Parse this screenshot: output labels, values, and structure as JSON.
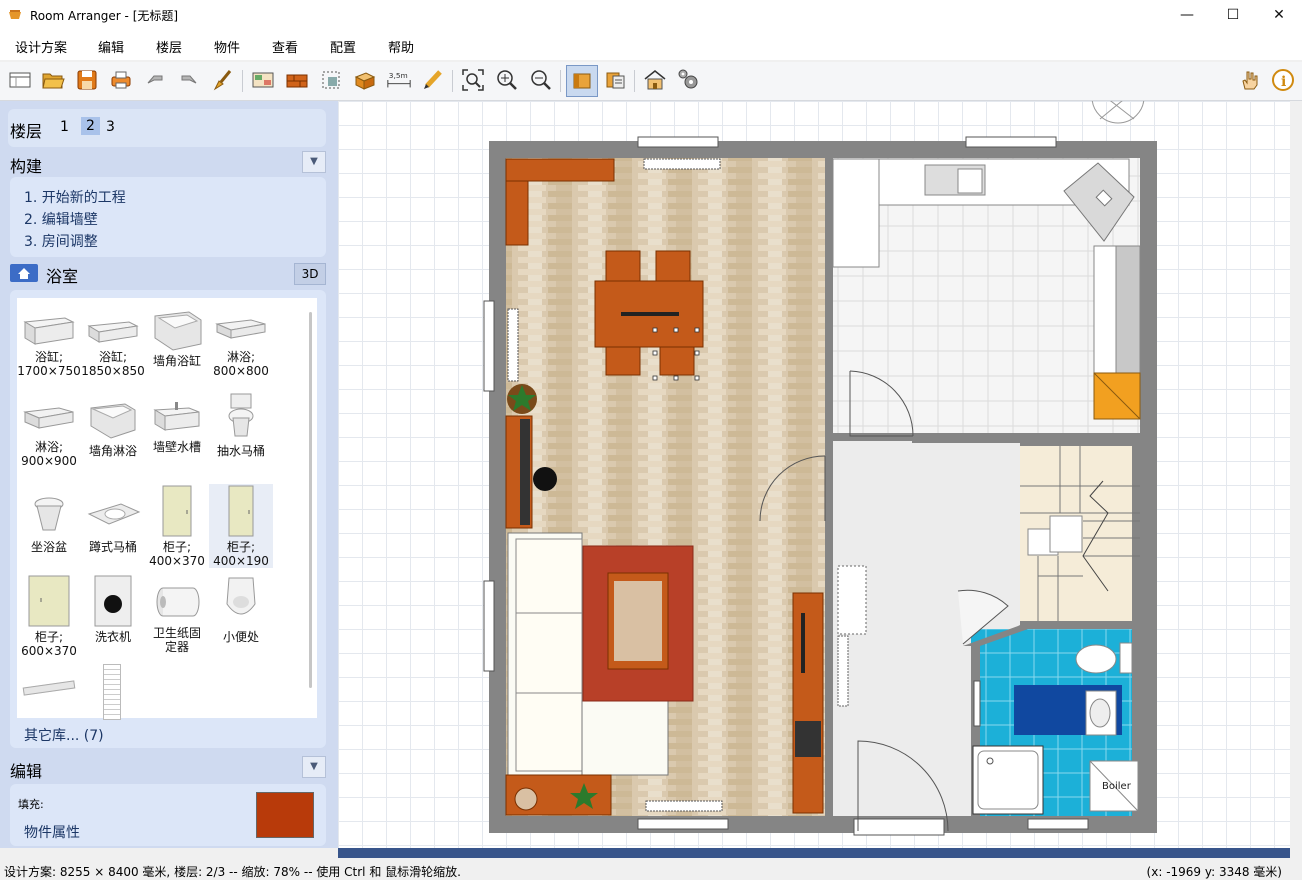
{
  "window": {
    "title": "Room Arranger - [无标题]",
    "minimize": "—",
    "maximize": "☐",
    "close": "✕"
  },
  "menu": [
    "设计方案",
    "编辑",
    "楼层",
    "物件",
    "查看",
    "配置",
    "帮助"
  ],
  "toolbar": {
    "icons": [
      "new-icon",
      "open-folder-icon",
      "save-icon",
      "print-icon",
      "undo-icon",
      "redo-icon",
      "brush-icon",
      "room-icon",
      "wall-icon",
      "select-icon",
      "object-icon",
      "measure-icon",
      "pencil-icon",
      "zoom-fit-icon",
      "zoom-in-icon",
      "zoom-out-icon",
      "view-2d-icon",
      "view-3d-icon",
      "house-3d-icon",
      "settings-icon",
      "hand-icon",
      "info-icon"
    ],
    "measure_label": "3,5m"
  },
  "floors": {
    "label": "楼层",
    "items": [
      "1",
      "2",
      "3"
    ],
    "selected": "2"
  },
  "build": {
    "title": "构建",
    "steps": [
      "1. 开始新的工程",
      "2. 编辑墙壁",
      "3. 房间调整"
    ]
  },
  "library": {
    "title": "浴室",
    "button_3d": "3D",
    "items": [
      {
        "label": "浴缸;\n1700×750"
      },
      {
        "label": "浴缸;\n1850×850"
      },
      {
        "label": "墙角浴缸"
      },
      {
        "label": "淋浴;\n800×800"
      },
      {
        "label": "淋浴;\n900×900"
      },
      {
        "label": "墙角淋浴"
      },
      {
        "label": "墙壁水槽"
      },
      {
        "label": "抽水马桶"
      },
      {
        "label": "坐浴盆"
      },
      {
        "label": "蹲式马桶"
      },
      {
        "label": "柜子;\n400×370"
      },
      {
        "label": "柜子;\n400×190"
      },
      {
        "label": "柜子;\n600×370"
      },
      {
        "label": "洗衣机"
      },
      {
        "label": "卫生纸固\n定器"
      },
      {
        "label": "小便处"
      }
    ],
    "other": "其它库... (7)"
  },
  "edit": {
    "title": "编辑",
    "fill_label": "填充:",
    "properties": "物件属性",
    "fill_color": "#b83a0a"
  },
  "plan": {
    "boiler_label": "Boiler"
  },
  "status": {
    "left": "设计方案: 8255 × 8400 毫米, 楼层: 2/3 -- 缩放: 78% -- 使用 Ctrl 和 鼠标滑轮缩放.",
    "right": "(x: -1969 y: 3348 毫米)"
  }
}
